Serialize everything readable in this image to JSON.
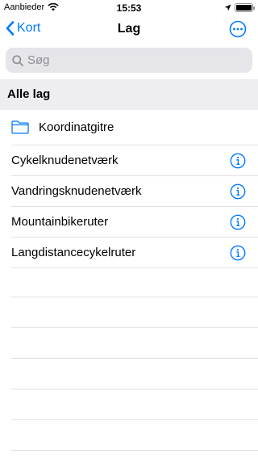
{
  "status_bar": {
    "carrier": "Aanbieder",
    "time": "15:53"
  },
  "nav": {
    "back_label": "Kort",
    "title": "Lag"
  },
  "search": {
    "placeholder": "Søg"
  },
  "section": {
    "title": "Alle lag"
  },
  "folder": {
    "label": "Koordinatgitre"
  },
  "layers": [
    {
      "label": "Cykelknudenetværk"
    },
    {
      "label": "Vandringsknudenetværk"
    },
    {
      "label": "Mountainbikeruter"
    },
    {
      "label": "Langdistancecykelruter"
    }
  ],
  "icons": {
    "back": "chevron-left-icon",
    "more": "ellipsis-circle-icon",
    "search": "magnifier-icon",
    "folder": "folder-icon",
    "info": "info-circle-icon",
    "wifi": "wifi-icon",
    "location": "location-arrow-icon",
    "battery": "battery-icon"
  },
  "colors": {
    "accent": "#007aff",
    "section_bg": "#eeeef2",
    "separator": "#e2e2e6"
  }
}
